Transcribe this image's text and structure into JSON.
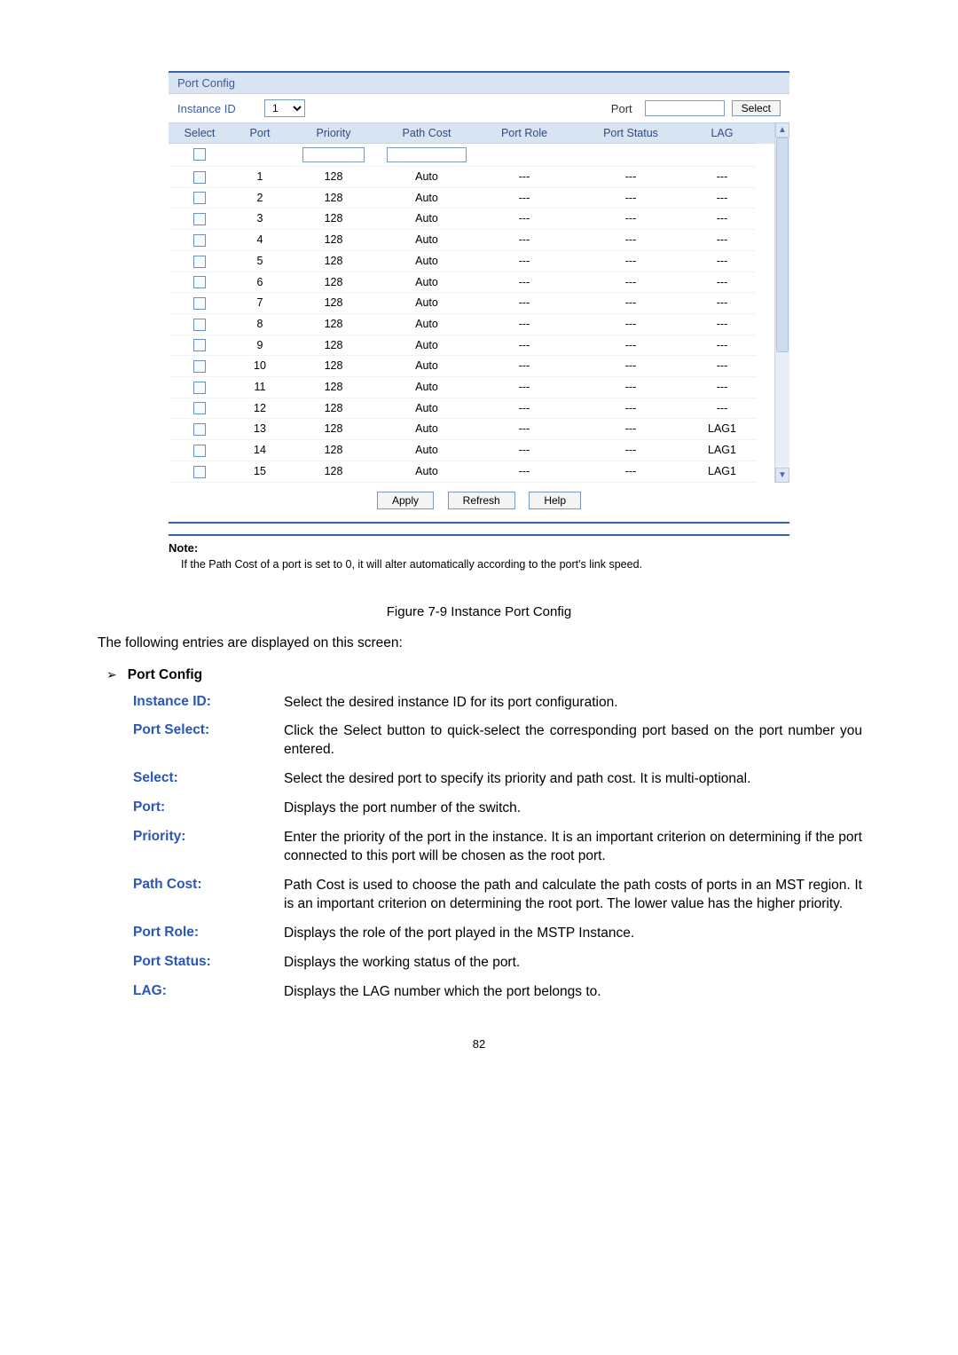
{
  "panel": {
    "title": "Port Config",
    "instance_label": "Instance ID",
    "instance_value": "1",
    "port_label": "Port",
    "port_input": "",
    "select_btn": "Select",
    "headers": {
      "select": "Select",
      "port": "Port",
      "priority": "Priority",
      "pathcost": "Path Cost",
      "portrole": "Port Role",
      "portstatus": "Port Status",
      "lag": "LAG"
    },
    "header_inputs": {
      "priority": "",
      "pathcost": ""
    },
    "rows": [
      {
        "port": "1",
        "priority": "128",
        "pathcost": "Auto",
        "role": "---",
        "status": "---",
        "lag": "---"
      },
      {
        "port": "2",
        "priority": "128",
        "pathcost": "Auto",
        "role": "---",
        "status": "---",
        "lag": "---"
      },
      {
        "port": "3",
        "priority": "128",
        "pathcost": "Auto",
        "role": "---",
        "status": "---",
        "lag": "---"
      },
      {
        "port": "4",
        "priority": "128",
        "pathcost": "Auto",
        "role": "---",
        "status": "---",
        "lag": "---"
      },
      {
        "port": "5",
        "priority": "128",
        "pathcost": "Auto",
        "role": "---",
        "status": "---",
        "lag": "---"
      },
      {
        "port": "6",
        "priority": "128",
        "pathcost": "Auto",
        "role": "---",
        "status": "---",
        "lag": "---"
      },
      {
        "port": "7",
        "priority": "128",
        "pathcost": "Auto",
        "role": "---",
        "status": "---",
        "lag": "---"
      },
      {
        "port": "8",
        "priority": "128",
        "pathcost": "Auto",
        "role": "---",
        "status": "---",
        "lag": "---"
      },
      {
        "port": "9",
        "priority": "128",
        "pathcost": "Auto",
        "role": "---",
        "status": "---",
        "lag": "---"
      },
      {
        "port": "10",
        "priority": "128",
        "pathcost": "Auto",
        "role": "---",
        "status": "---",
        "lag": "---"
      },
      {
        "port": "11",
        "priority": "128",
        "pathcost": "Auto",
        "role": "---",
        "status": "---",
        "lag": "---"
      },
      {
        "port": "12",
        "priority": "128",
        "pathcost": "Auto",
        "role": "---",
        "status": "---",
        "lag": "---"
      },
      {
        "port": "13",
        "priority": "128",
        "pathcost": "Auto",
        "role": "---",
        "status": "---",
        "lag": "LAG1"
      },
      {
        "port": "14",
        "priority": "128",
        "pathcost": "Auto",
        "role": "---",
        "status": "---",
        "lag": "LAG1"
      },
      {
        "port": "15",
        "priority": "128",
        "pathcost": "Auto",
        "role": "---",
        "status": "---",
        "lag": "LAG1"
      }
    ],
    "buttons": {
      "apply": "Apply",
      "refresh": "Refresh",
      "help": "Help"
    }
  },
  "note": {
    "label": "Note:",
    "text": "If the Path Cost of a port is set to 0, it will alter automatically according to the port's link speed."
  },
  "caption": "Figure 7-9 Instance Port Config",
  "intro": "The following entries are displayed on this screen:",
  "bullet_heading": "Port Config",
  "defs": [
    {
      "term": "Instance ID:",
      "desc": "Select the desired instance ID for its port configuration."
    },
    {
      "term": "Port Select:",
      "desc": "Click the Select button to quick-select the corresponding port based on the port number you entered."
    },
    {
      "term": "Select:",
      "desc": "Select the desired port to specify its priority and path cost. It is multi-optional."
    },
    {
      "term": "Port:",
      "desc": "Displays the port number of the switch."
    },
    {
      "term": "Priority:",
      "desc": "Enter the priority of the port in the instance. It is an important criterion on determining if the port connected to this port will be chosen as the root port."
    },
    {
      "term": "Path Cost:",
      "desc": "Path Cost is used to choose the path and calculate the path costs of ports in an MST region. It is an important criterion on determining the root port. The lower value has the higher priority."
    },
    {
      "term": "Port Role:",
      "desc": "Displays the role of the port played in the MSTP Instance."
    },
    {
      "term": "Port Status:",
      "desc": "Displays the working status of the port."
    },
    {
      "term": "LAG:",
      "desc": "Displays the LAG number which the port belongs to."
    }
  ],
  "pagenum": "82"
}
